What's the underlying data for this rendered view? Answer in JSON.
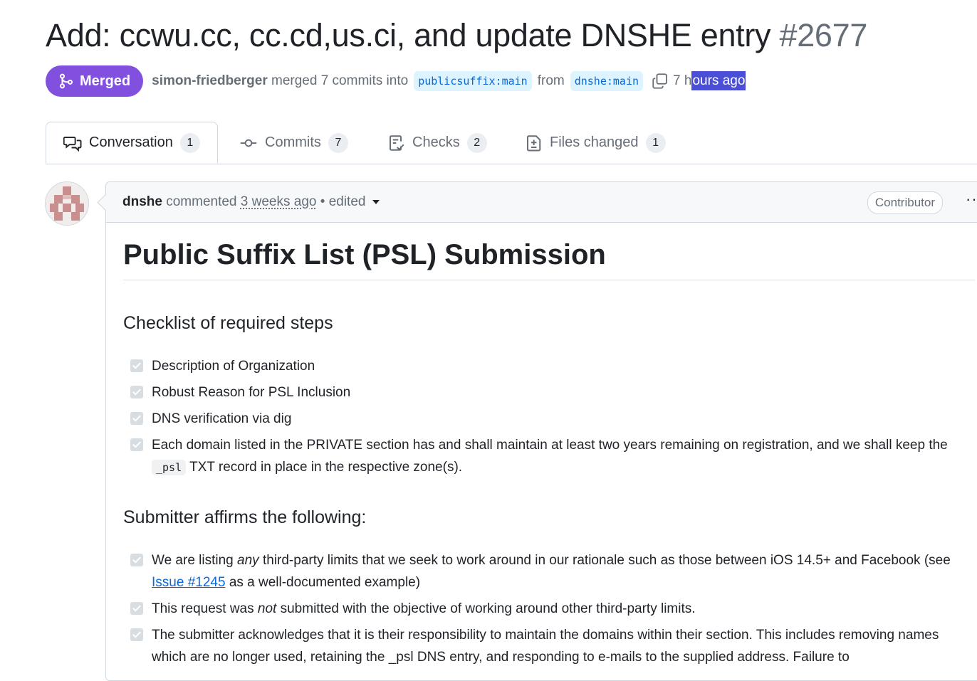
{
  "pr": {
    "title": "Add: ccwu.cc, cc.cd,us.ci, and update DNSHE entry",
    "number": "#2677",
    "status": "Merged",
    "author": "simon-friedberger",
    "action": "merged 7 commits into",
    "base_branch": "publicsuffix:main",
    "from_word": "from",
    "head_branch": "dnshe:main",
    "time_prefix": "7 h",
    "time_selected": "ours ago"
  },
  "tabs": [
    {
      "label": "Conversation",
      "count": "1",
      "icon": "comment-discussion-icon"
    },
    {
      "label": "Commits",
      "count": "7",
      "icon": "git-commit-icon"
    },
    {
      "label": "Checks",
      "count": "2",
      "icon": "checklist-icon"
    },
    {
      "label": "Files changed",
      "count": "1",
      "icon": "file-diff-icon"
    }
  ],
  "comment": {
    "author": "dnshe",
    "verb": "commented",
    "when": "3 weeks ago",
    "edited": "• edited",
    "role": "Contributor",
    "more": "···"
  },
  "doc": {
    "heading": "Public Suffix List (PSL) Submission",
    "section1": "Checklist of required steps",
    "checklist": [
      "Description of Organization",
      "Robust Reason for PSL Inclusion",
      "DNS verification via dig"
    ],
    "item4_a": "Each domain listed in the PRIVATE section has and shall maintain at least two years remaining on registration, and we shall keep the",
    "item4_code": "_psl",
    "item4_b": "TXT record in place in the respective zone(s).",
    "section2": "Submitter affirms the following:",
    "aff1_a": "We are listing",
    "aff1_em": "any",
    "aff1_b": "third-party limits that we seek to work around in our rationale such as those between iOS 14.5+ and Facebook (see",
    "aff1_link": "Issue #1245",
    "aff1_c": "as a well-documented example)",
    "aff2_a": "This request was",
    "aff2_em": "not",
    "aff2_b": "submitted with the objective of working around other third-party limits.",
    "aff3": "The submitter acknowledges that it is their responsibility to maintain the domains within their section. This includes removing names which are no longer used, retaining the _psl DNS entry, and responding to e-mails to the supplied address. Failure to"
  },
  "colors": {
    "merged": "#8250df",
    "link": "#0969da",
    "selection": "#4b4fd8"
  }
}
